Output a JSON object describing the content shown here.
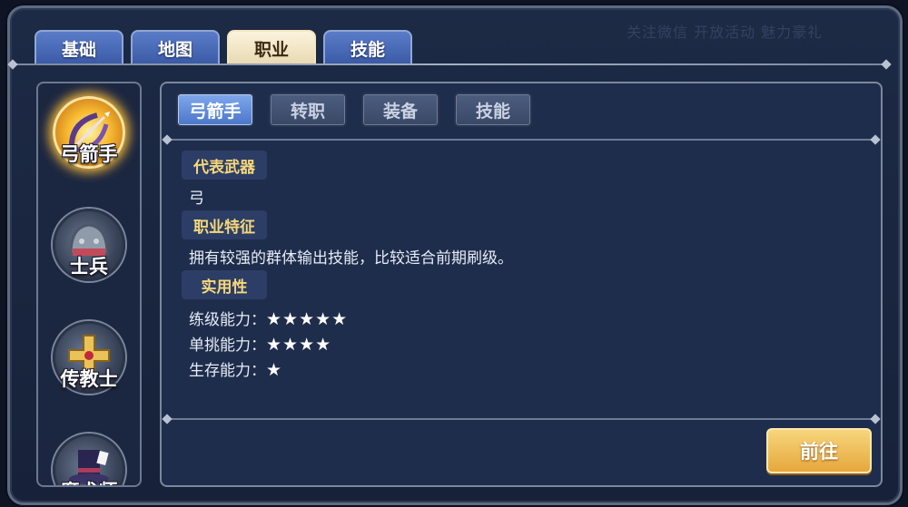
{
  "background_text": "关注微信  开放活动  魅力豪礼",
  "tabs": [
    {
      "label": "基础",
      "active": false
    },
    {
      "label": "地图",
      "active": false
    },
    {
      "label": "职业",
      "active": true
    },
    {
      "label": "技能",
      "active": false
    }
  ],
  "classes": [
    {
      "label": "弓箭手",
      "icon": "bow-icon",
      "selected": true
    },
    {
      "label": "士兵",
      "icon": "helmet-icon",
      "selected": false
    },
    {
      "label": "传教士",
      "icon": "cross-icon",
      "selected": false
    },
    {
      "label": "魔术师",
      "icon": "top-hat-icon",
      "selected": false
    }
  ],
  "subtabs": [
    {
      "label": "弓箭手",
      "active": true
    },
    {
      "label": "转职",
      "active": false
    },
    {
      "label": "装备",
      "active": false
    },
    {
      "label": "技能",
      "active": false
    }
  ],
  "sections": {
    "weapon": {
      "title": "代表武器",
      "text": "弓"
    },
    "feature": {
      "title": "职业特征",
      "text": "拥有较强的群体输出技能，比较适合前期刷级。"
    },
    "practicality": {
      "title": "实用性",
      "ratings": [
        {
          "label": "练级能力：",
          "stars": "★★★★★",
          "value": 5
        },
        {
          "label": "单挑能力：",
          "stars": "★★★★",
          "value": 4
        },
        {
          "label": "生存能力：",
          "stars": "★",
          "value": 1
        }
      ]
    }
  },
  "go_button": "前往",
  "colors": {
    "accent_gold": "#f6d77a",
    "tab_active": "#fbf3dd",
    "tab_inactive": "#4a6bb8",
    "button_gold": "#e6a73c"
  }
}
